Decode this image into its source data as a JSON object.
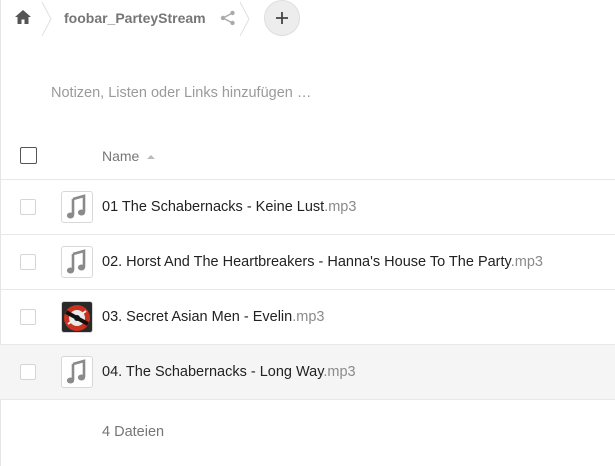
{
  "breadcrumb": {
    "home_icon": "home-icon",
    "folder_name": "foobar_ParteyStream",
    "share_icon": "share-icon",
    "add_icon": "plus-icon"
  },
  "notes": {
    "placeholder": "Notizen, Listen oder Links hinzufügen …"
  },
  "table": {
    "header": {
      "name_label": "Name",
      "sort": "ascending"
    },
    "rows": [
      {
        "name": "01 The Schabernacks - Keine Lust",
        "ext": ".mp3",
        "thumb": "music-note-icon",
        "highlighted": false
      },
      {
        "name": "02. Horst And The Heartbreakers - Hanna's House To The Party",
        "ext": ".mp3",
        "thumb": "music-note-icon",
        "highlighted": false
      },
      {
        "name": "03. Secret Asian Men - Evelin",
        "ext": ".mp3",
        "thumb": "album-art",
        "highlighted": false
      },
      {
        "name": "04. The Schabernacks - Long Way",
        "ext": ".mp3",
        "thumb": "music-note-icon",
        "highlighted": true
      }
    ],
    "summary": "4 Dateien"
  },
  "colors": {
    "text": "#222222",
    "muted": "#767676",
    "extension": "#8a8a8a",
    "border": "#e8e8e8",
    "highlight": "#f5f5f5"
  }
}
